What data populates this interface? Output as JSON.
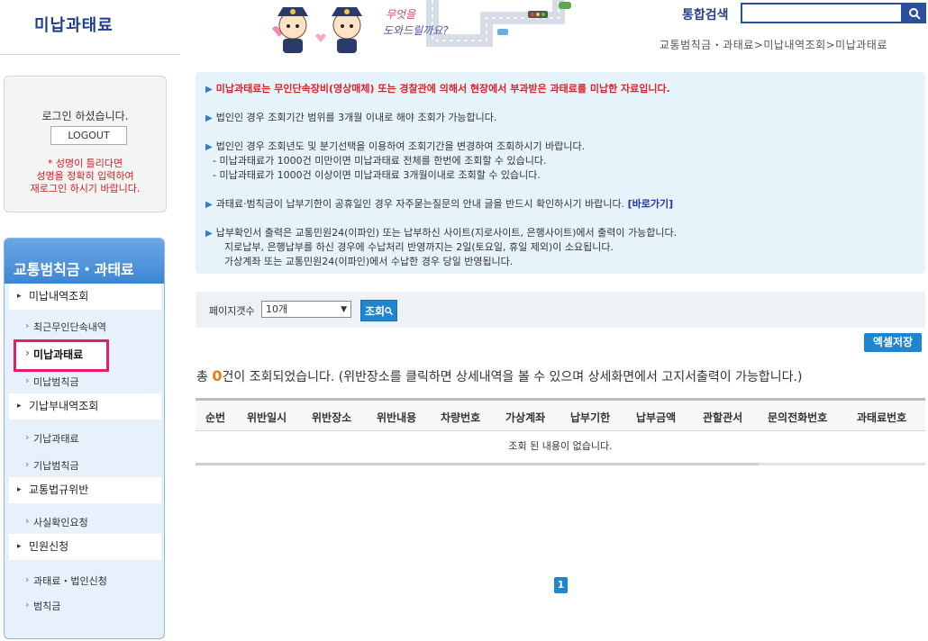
{
  "header": {
    "site_title": "미납과태료",
    "mascot_caption": "무엇을 도와드릴까요?",
    "search_label": "통합검색",
    "search_value": "",
    "breadcrumb": "교통범칙금・과태료>미납내역조회>미납과태료"
  },
  "login": {
    "message": "로그인 하셨습니다.",
    "logout_label": "LOGOUT",
    "warning_lines": [
      "* 성명이 틀리다면",
      "성명을 정확히 입력하여",
      "재로그인 하시기 바랍니다."
    ]
  },
  "menu": {
    "title": "교통범칙금・과태료",
    "sections": [
      {
        "label": "미납내역조회",
        "items": [
          "최근무인단속내역",
          "미납과태료",
          "미납범칙금"
        ]
      },
      {
        "label": "기납부내역조회",
        "items": [
          "기납과태료",
          "기납범칙금"
        ]
      },
      {
        "label": "교통법규위반",
        "items": [
          "사실확인요청"
        ]
      },
      {
        "label": "민원신청",
        "items": [
          "과태료・법인신청",
          "범칙금"
        ]
      }
    ],
    "active_item": "미납과태료"
  },
  "notice": {
    "line1": "미납과태료는 무인단속장비(영상매체) 또는 경찰관에 의해서 현장에서 부과받은 과태료를 미납한 자료입니다.",
    "line2": "법인인 경우 조회기간 범위를 3개월 이내로 해야 조회가 가능합니다.",
    "line3": "법인인 경우 조회년도 및 분기선택을 이용하여 조회기간을 변경하여 조회하시기 바랍니다.",
    "line3a": "- 미납과태료가 1000건 미만이면 미납과태료 전체를 한번에 조회할 수 있습니다.",
    "line3b": "- 미납과태료가 1000건 이상이면 미납과태료 3개월이내로 조회할 수 있습니다.",
    "line4": "과태료·범칙금이 납부기한이 공휴일인 경우 자주묻는질문의 안내 글을 반드시 확인하시기 바랍니다.",
    "line4_link": "[바로가기]",
    "line5": "납부확인서 출력은 교통민원24(이파인) 또는 납부하신 사이트(지로사이트, 은행사이트)에서 출력이 가능합니다.",
    "line5a": "지로납부, 은행납부를 하신 경우에 수납처리 반영까지는 2일(토요일, 휴일 제외)이 소요됩니다.",
    "line5b": "가상계좌 또는 교통민원24(이파인)에서 수납한 경우 당일 반영됩니다."
  },
  "controls": {
    "page_count_label": "페이지갯수",
    "page_count_value": "10개",
    "search_button": "조회",
    "excel_button": "엑셀저장"
  },
  "results": {
    "prefix": "총 ",
    "count": "0",
    "suffix": "건이 조회되었습니다. (위반장소를 클릭하면 상세내역을 볼 수 있으며 상세화면에서 고지서출력이 가능합니다.)",
    "columns": [
      "순번",
      "위반일시",
      "위반장소",
      "위반내용",
      "차량번호",
      "가상계좌",
      "납부기한",
      "납부금액",
      "관할관서",
      "문의전화번호",
      "과태료번호"
    ],
    "empty_message": "조회 된 내용이 없습니다.",
    "page": "1"
  }
}
